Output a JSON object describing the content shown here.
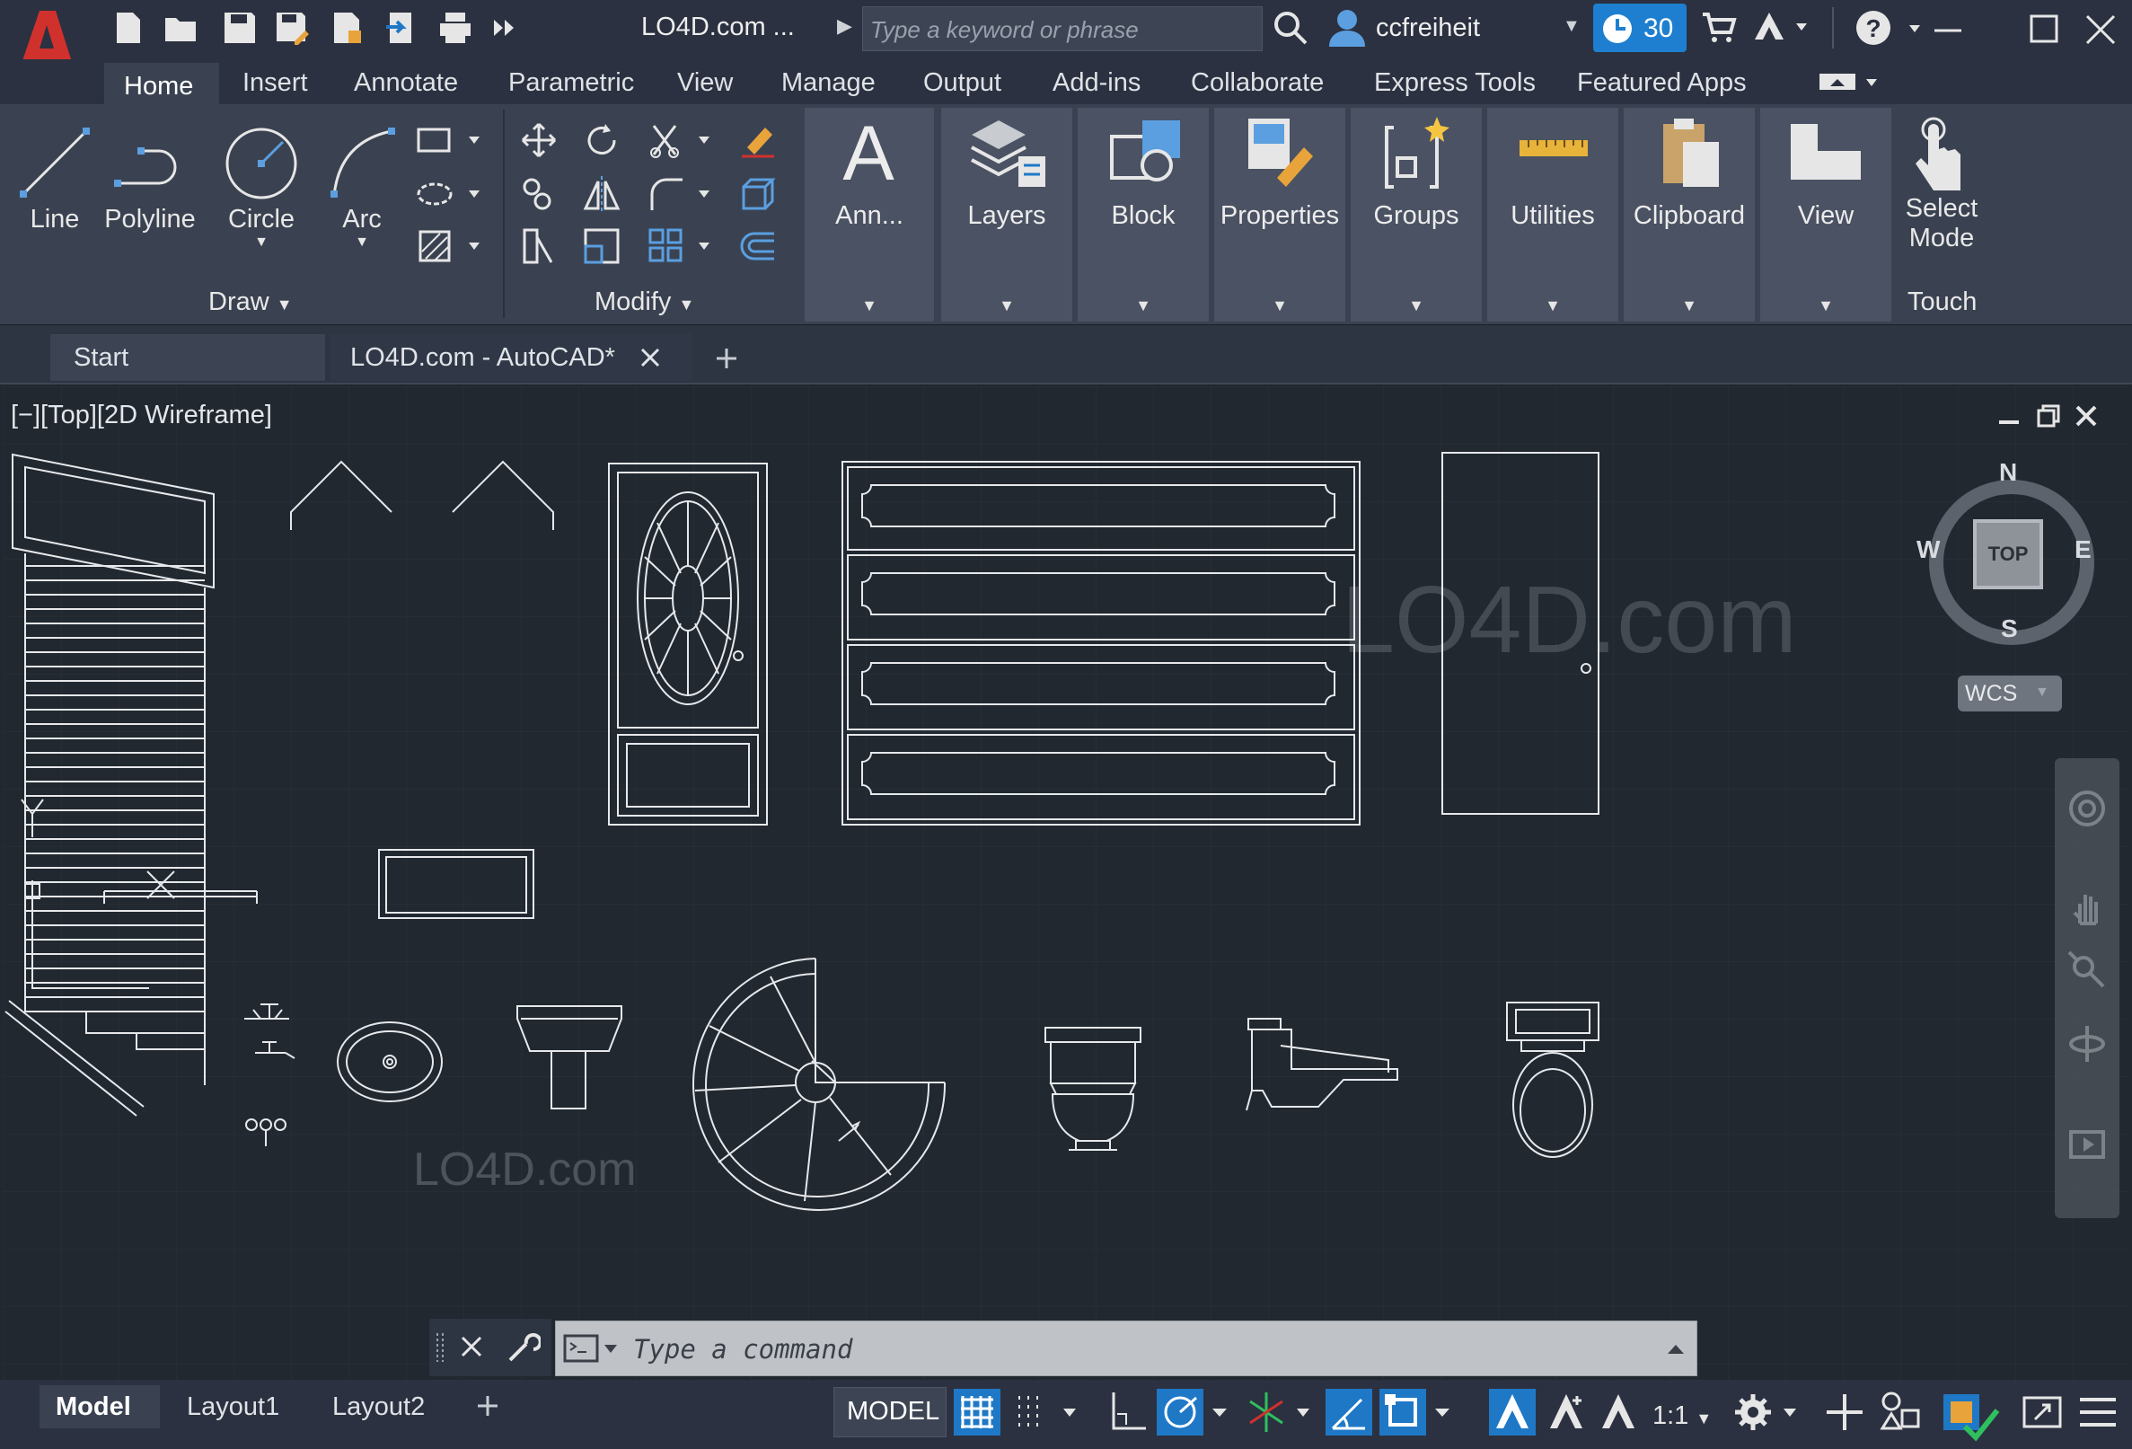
{
  "title": {
    "doc_title": "LO4D.com ...",
    "search_placeholder": "Type a keyword or phrase",
    "user_name": "ccfreiheit",
    "trial_days": "30"
  },
  "ribbon_tabs": [
    "Home",
    "Insert",
    "Annotate",
    "Parametric",
    "View",
    "Manage",
    "Output",
    "Add-ins",
    "Collaborate",
    "Express Tools",
    "Featured Apps"
  ],
  "ribbon": {
    "draw_tools": [
      "Line",
      "Polyline",
      "Circle",
      "Arc"
    ],
    "draw_panel": "Draw",
    "modify_panel": "Modify",
    "panels": [
      "Ann...",
      "Layers",
      "Block",
      "Properties",
      "Groups",
      "Utilities",
      "Clipboard",
      "View"
    ],
    "select_mode_line1": "Select",
    "select_mode_line2": "Mode",
    "touch_panel": "Touch"
  },
  "doc_tabs": {
    "start": "Start",
    "active": "LO4D.com - AutoCAD*"
  },
  "viewport": {
    "label": "[−][Top][2D Wireframe]",
    "compass": {
      "n": "N",
      "s": "S",
      "e": "E",
      "w": "W"
    },
    "viewcube_face": "TOP",
    "ucs": "WCS",
    "watermark": "LO4D.com"
  },
  "command": {
    "prompt": "Type a command"
  },
  "status": {
    "layout_tabs": [
      "Model",
      "Layout1",
      "Layout2"
    ],
    "model_space": "MODEL",
    "scale": "1:1"
  },
  "colors": {
    "background": "#212830",
    "ribbon": "#3a4251",
    "accent": "#1f78c6",
    "logo": "#d0312d",
    "linework": "#e6e8eb"
  }
}
